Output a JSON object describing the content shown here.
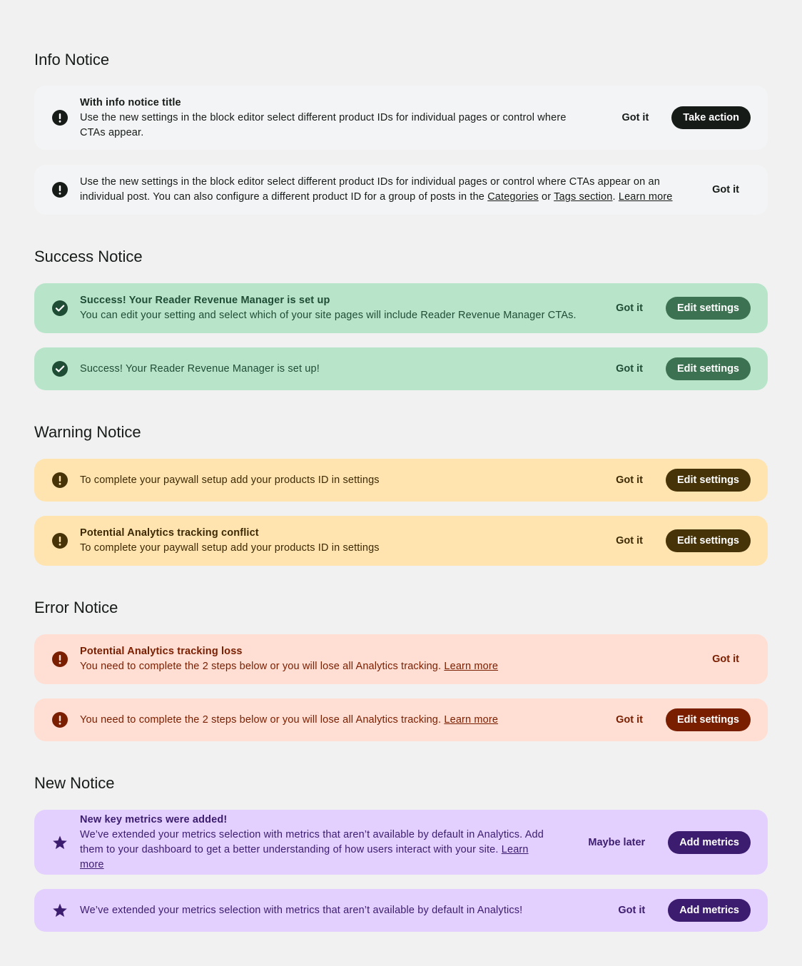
{
  "sections": {
    "info": {
      "heading": "Info Notice",
      "notice1": {
        "title": "With info notice title",
        "description": "Use the new settings in the block editor select different product IDs for individual pages or control where CTAs appear.",
        "dismiss_label": "Got it",
        "cta_label": "Take action",
        "icon": "exclamation-circle-icon"
      },
      "notice2": {
        "description_part1": "Use the new settings in the block editor select different product IDs for individual pages or control where CTAs appear on an individual post. You can also configure a different product ID for a group of posts in the ",
        "link_categories": "Categories",
        "description_or": " or ",
        "link_tags": "Tags section",
        "description_period": ". ",
        "link_learn_more": "Learn more",
        "dismiss_label": "Got it",
        "icon": "exclamation-circle-icon"
      }
    },
    "success": {
      "heading": "Success Notice",
      "notice1": {
        "title": "Success! Your Reader Revenue Manager is set up",
        "description": "You can edit your setting and select which of your site pages will include Reader Revenue Manager CTAs.",
        "dismiss_label": "Got it",
        "cta_label": "Edit settings",
        "icon": "check-circle-icon"
      },
      "notice2": {
        "description": "Success! Your Reader Revenue Manager is set up!",
        "dismiss_label": "Got it",
        "cta_label": "Edit settings",
        "icon": "check-circle-icon"
      }
    },
    "warning": {
      "heading": "Warning Notice",
      "notice1": {
        "description": "To complete your paywall setup add your products ID in settings",
        "dismiss_label": "Got it",
        "cta_label": "Edit settings",
        "icon": "exclamation-circle-icon"
      },
      "notice2": {
        "title": "Potential Analytics tracking conflict",
        "description": "To complete your paywall setup add your products ID in settings",
        "dismiss_label": "Got it",
        "cta_label": "Edit settings",
        "icon": "exclamation-circle-icon"
      }
    },
    "error": {
      "heading": "Error Notice",
      "notice1": {
        "title": "Potential Analytics tracking loss",
        "description": "You need to complete the 2 steps below or you will lose all Analytics tracking. ",
        "link_learn_more": "Learn more",
        "dismiss_label": "Got it",
        "icon": "exclamation-circle-icon"
      },
      "notice2": {
        "description": "You need to complete the 2 steps below or you will lose all Analytics tracking. ",
        "link_learn_more": "Learn more",
        "dismiss_label": "Got it",
        "cta_label": "Edit settings",
        "icon": "exclamation-circle-icon"
      }
    },
    "new": {
      "heading": "New Notice",
      "notice1": {
        "title": "New key metrics were added!",
        "description": "We’ve extended your metrics selection with metrics that aren’t available by default in Analytics. Add them to your dashboard to get a better understanding of how users interact with your site. ",
        "link_learn_more": "Learn more",
        "dismiss_label": "Maybe later",
        "cta_label": "Add metrics",
        "icon": "star-icon"
      },
      "notice2": {
        "description": "We’ve extended your metrics selection with metrics that aren’t available by default in Analytics!",
        "dismiss_label": "Got it",
        "cta_label": "Add metrics",
        "icon": "star-icon"
      }
    }
  },
  "colors": {
    "page_background": "#f1f1f1",
    "info_background": "#f3f4f5",
    "success_background": "#b8e5ca",
    "warning_background": "#ffe4b0",
    "error_background": "#ffded3",
    "new_background": "#e3d0ff"
  }
}
